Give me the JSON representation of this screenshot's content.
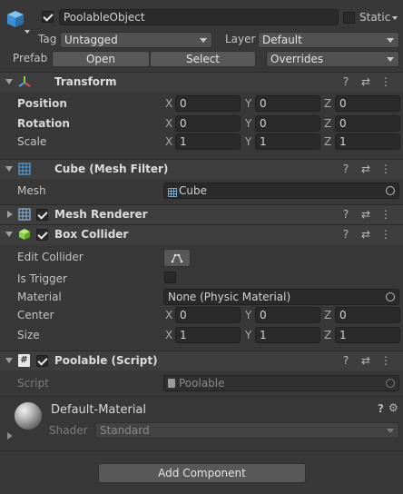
{
  "object": {
    "name": "PoolableObject",
    "static_label": "Static",
    "tag_label": "Tag",
    "tag_value": "Untagged",
    "layer_label": "Layer",
    "layer_value": "Default",
    "prefab_label": "Prefab",
    "prefab_open": "Open",
    "prefab_select": "Select",
    "prefab_overrides": "Overrides"
  },
  "transform": {
    "title": "Transform",
    "position_label": "Position",
    "rotation_label": "Rotation",
    "scale_label": "Scale",
    "x": "X",
    "y": "Y",
    "z": "Z",
    "position": [
      "0",
      "0",
      "0"
    ],
    "rotation": [
      "0",
      "0",
      "0"
    ],
    "scale": [
      "1",
      "1",
      "1"
    ]
  },
  "mesh_filter": {
    "title": "Cube (Mesh Filter)",
    "mesh_label": "Mesh",
    "mesh_value": "Cube"
  },
  "mesh_renderer": {
    "title": "Mesh Renderer"
  },
  "box_collider": {
    "title": "Box Collider",
    "edit_collider_label": "Edit Collider",
    "is_trigger_label": "Is Trigger",
    "material_label": "Material",
    "material_value": "None (Physic Material)",
    "center_label": "Center",
    "size_label": "Size",
    "center": [
      "0",
      "0",
      "0"
    ],
    "size": [
      "1",
      "1",
      "1"
    ]
  },
  "poolable_script": {
    "title": "Poolable (Script)",
    "script_label": "Script",
    "script_value": "Poolable"
  },
  "material": {
    "name": "Default-Material",
    "shader_label": "Shader",
    "shader_value": "Standard"
  },
  "add_component": "Add Component",
  "icons": {
    "header_help": "?",
    "header_presets": "⇄",
    "header_menu": "⋮"
  },
  "colors": {
    "background": "#383838",
    "header": "#3e3e3e",
    "field": "#2a2a2a",
    "accent_cube": "#4fa3e0",
    "accent_collider": "#8bd34a"
  }
}
